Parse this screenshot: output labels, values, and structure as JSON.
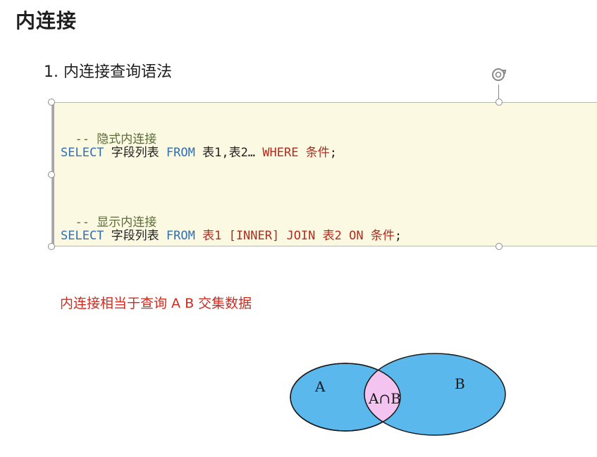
{
  "page": {
    "title": "内连接",
    "section_title": "1. 内连接查询语法"
  },
  "code": {
    "comment_implicit": "-- 隐式内连接",
    "line1": {
      "select": "SELECT",
      "fields": " 字段列表 ",
      "from": "FROM",
      "tables_a": " 表1,表2… ",
      "where": "WHERE",
      "cond": " 条件",
      "end": ";"
    },
    "comment_explicit": "-- 显示内连接",
    "line2": {
      "select": "SELECT",
      "fields": " 字段列表 ",
      "from": "FROM",
      "t1": " 表1 ",
      "inner": "[INNER] JOIN",
      "t2": " 表2 ",
      "on": "ON",
      "cond": " 条件",
      "end": ";"
    }
  },
  "note": "内连接相当于查询 A B 交集数据",
  "venn": {
    "label_a": "A",
    "label_b": "B",
    "label_ab": "A∩B",
    "color_sets": "#5bb8ec",
    "color_intersection": "#f4c4f0",
    "color_stroke": "#1a1a1a"
  },
  "colors": {
    "keyword": "#2f6fb8",
    "keyword_red": "#b52a1d",
    "comment": "#5b6b3a",
    "code_bg": "#fbf9e2",
    "note": "#d12a1f"
  }
}
